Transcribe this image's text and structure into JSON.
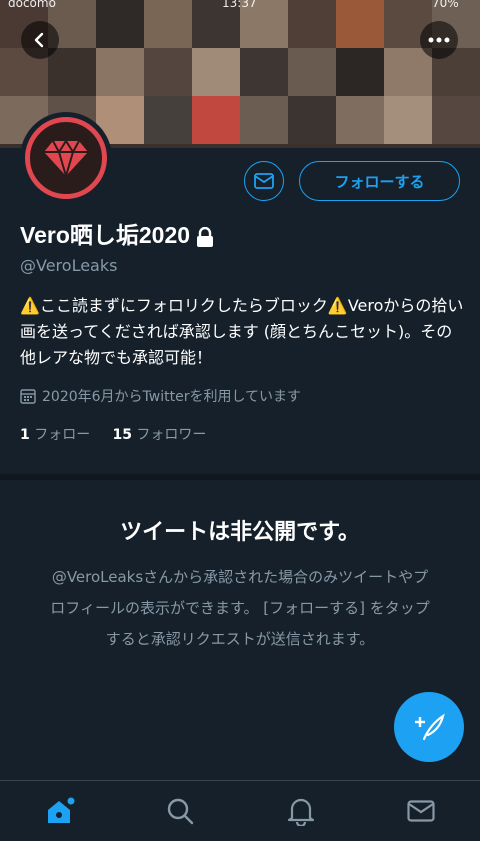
{
  "status_bar": {
    "carrier": "docomo",
    "time": "13:37",
    "battery": "70%"
  },
  "profile": {
    "display_name": "Vero晒し垢2020",
    "handle": "@VeroLeaks",
    "bio": "⚠️ここ読まずにフォロリクしたらブロック⚠️Veroからの拾い画を送ってくだされば承認します (顔とちんこセット)。その他レアな物でも承認可能！",
    "joined": "2020年6月からTwitterを利用しています",
    "following_count": "1",
    "following_label": "フォロー",
    "followers_count": "15",
    "followers_label": "フォロワー",
    "follow_button_label": "フォローする"
  },
  "private_notice": {
    "title": "ツイートは非公開です。",
    "text": "@VeroLeaksさんから承認された場合のみツイートやプロフィールの表示ができます。 [フォローする] をタップすると承認リクエストが送信されます。"
  },
  "icons": {
    "back": "back-icon",
    "more": "more-icon",
    "message": "envelope-icon",
    "lock": "lock-icon",
    "calendar": "calendar-icon",
    "compose": "compose-icon",
    "home": "home-icon",
    "search": "search-icon",
    "notifications": "bell-icon",
    "messages": "envelope-icon"
  },
  "colors": {
    "background": "#15202b",
    "accent": "#1da1f2",
    "secondary_text": "#8899a6",
    "avatar_ring": "#e0474f"
  }
}
